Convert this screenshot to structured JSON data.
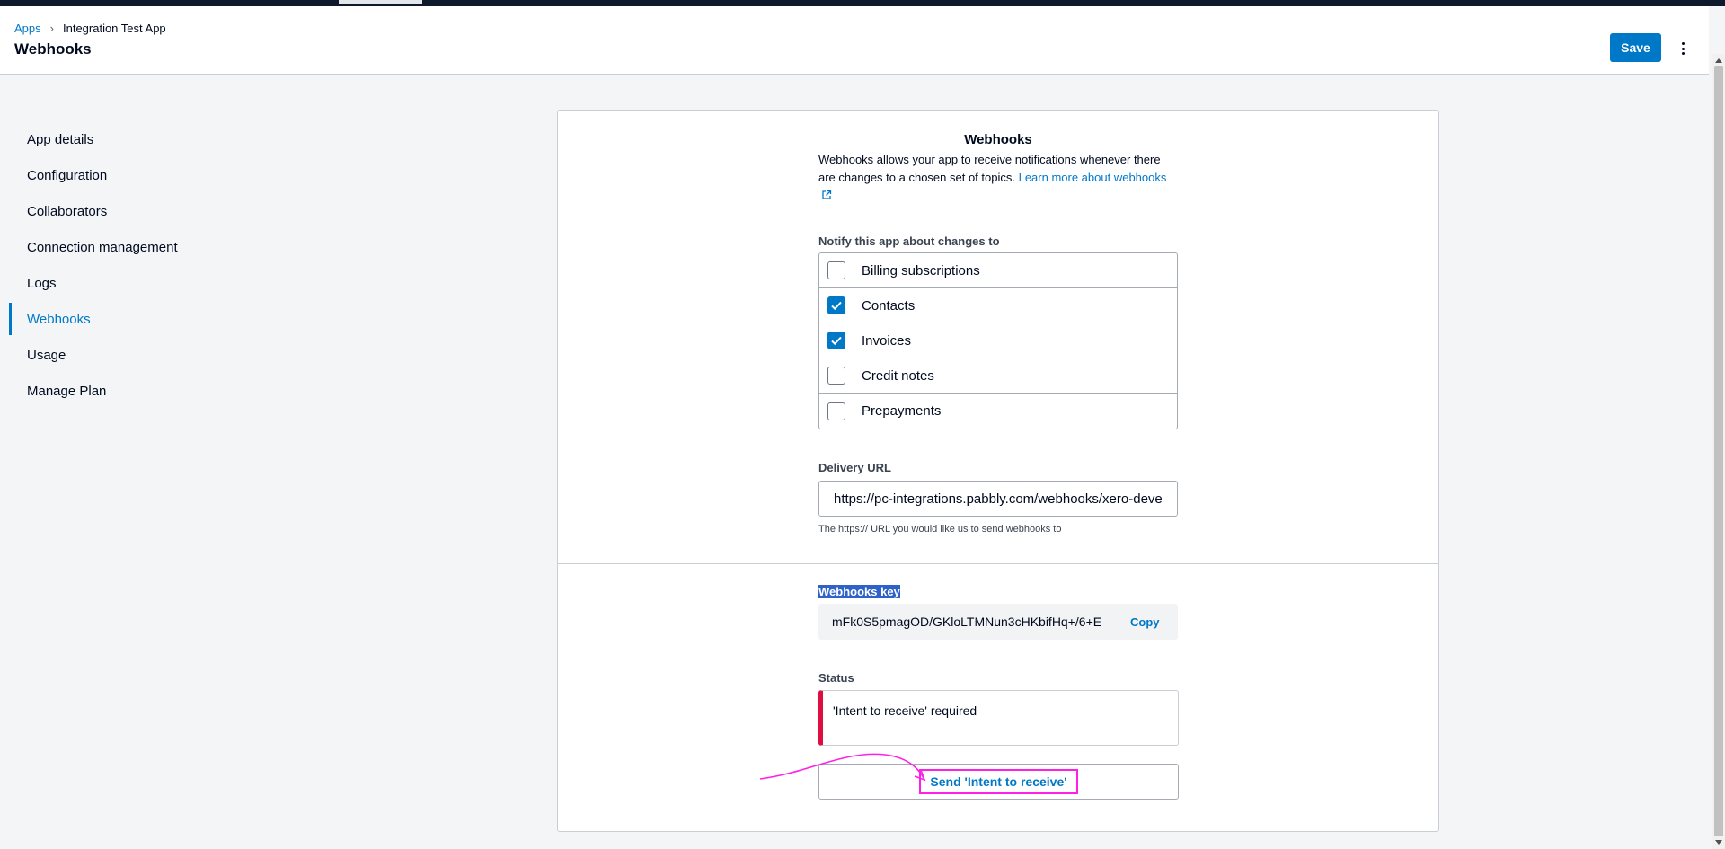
{
  "header": {
    "breadcrumb": {
      "root": "Apps",
      "separator": "›",
      "current": "Integration Test App"
    },
    "title": "Webhooks",
    "save_label": "Save",
    "more_icon": "more-vertical-icon"
  },
  "sidebar": {
    "items": [
      {
        "label": "App details",
        "active": false
      },
      {
        "label": "Configuration",
        "active": false
      },
      {
        "label": "Collaborators",
        "active": false
      },
      {
        "label": "Connection management",
        "active": false
      },
      {
        "label": "Logs",
        "active": false
      },
      {
        "label": "Webhooks",
        "active": true
      },
      {
        "label": "Usage",
        "active": false
      },
      {
        "label": "Manage Plan",
        "active": false
      }
    ]
  },
  "webhooks": {
    "title": "Webhooks",
    "intro_text": "Webhooks allows your app to receive notifications whenever there are changes to a chosen set of topics.",
    "learn_more": "Learn more about webhooks",
    "notify_label": "Notify this app about changes to",
    "topics": [
      {
        "label": "Billing subscriptions",
        "checked": false
      },
      {
        "label": "Contacts",
        "checked": true
      },
      {
        "label": "Invoices",
        "checked": true
      },
      {
        "label": "Credit notes",
        "checked": false
      },
      {
        "label": "Prepayments",
        "checked": false
      }
    ],
    "delivery_url_label": "Delivery URL",
    "delivery_url_value": "https://pc-integrations.pabbly.com/webhooks/xero-deve",
    "delivery_url_helper": "The https:// URL you would like us to send webhooks to",
    "key_label": "Webhooks key",
    "key_value": "mFk0S5pmagOD/GKloLTMNun3cHKbifHq+/6+E",
    "copy_label": "Copy",
    "status_label": "Status",
    "status_text": "'Intent to receive' required",
    "send_label": "Send 'Intent to receive'"
  },
  "colors": {
    "accent": "#0078c8",
    "error": "#de0e40",
    "annotation": "#ff1fe6"
  }
}
